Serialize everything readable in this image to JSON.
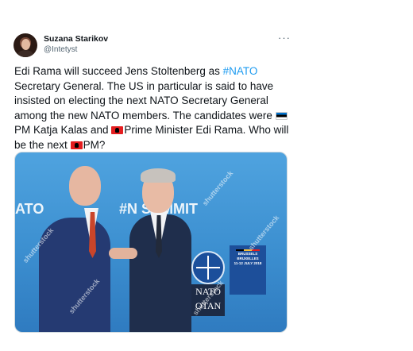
{
  "tweet": {
    "author_name": "Suzana Starikov",
    "author_handle": "@Intetyst",
    "more_label": "···",
    "text_1": "Edi Rama will succeed Jens Stoltenberg as ",
    "hashtag": "#NATO",
    "text_2": " Secretary General. The US in particular is said to have insisted on electing the next NATO Secretary General among the new NATO members. The candidates were ",
    "text_3": "PM Katja Kalas and ",
    "text_4": "Prime Minister Edi Rama. Who will be the next ",
    "text_5": "PM?"
  },
  "media": {
    "backdrop_left": "ATO",
    "backdrop_hash": "#N",
    "backdrop_summit": "SUMMIT",
    "sign_title": "BRUSSELS BRUXELLES",
    "sign_date": "11-12 JULY 2018",
    "nato_label": "NATO",
    "otan_label": "OTAN",
    "watermark": "shutterstock"
  },
  "icons": {
    "estonia_flag": "estonia-flag-icon",
    "albania_flag": "albania-flag-icon"
  }
}
